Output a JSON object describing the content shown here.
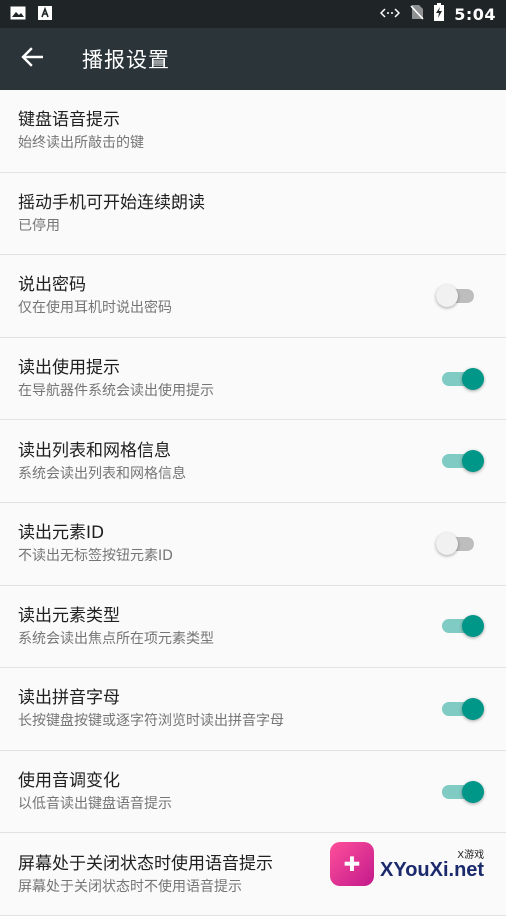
{
  "status_bar": {
    "time": "5:04",
    "icons": [
      "image-icon",
      "text-a-icon",
      "code-arrows-icon",
      "no-sim-icon",
      "battery-charging-icon"
    ]
  },
  "app_bar": {
    "title": "播报设置",
    "back_icon": "arrow-left-icon"
  },
  "settings": [
    {
      "title": "键盘语音提示",
      "subtitle": "始终读出所敲击的键",
      "toggle": null
    },
    {
      "title": "摇动手机可开始连续朗读",
      "subtitle": "已停用",
      "toggle": null
    },
    {
      "title": "说出密码",
      "subtitle": "仅在使用耳机时说出密码",
      "toggle": "off"
    },
    {
      "title": "读出使用提示",
      "subtitle": "在导航器件系统会读出使用提示",
      "toggle": "on"
    },
    {
      "title": "读出列表和网格信息",
      "subtitle": "系统会读出列表和网格信息",
      "toggle": "on"
    },
    {
      "title": "读出元素ID",
      "subtitle": "不读出无标签按钮元素ID",
      "toggle": "off"
    },
    {
      "title": "读出元素类型",
      "subtitle": "系统会读出焦点所在项元素类型",
      "toggle": "on"
    },
    {
      "title": "读出拼音字母",
      "subtitle": "长按键盘按键或逐字符浏览时读出拼音字母",
      "toggle": "on"
    },
    {
      "title": "使用音调变化",
      "subtitle": "以低音读出键盘语音提示",
      "toggle": "on"
    },
    {
      "title": "屏幕处于关闭状态时使用语音提示",
      "subtitle": "屏幕处于关闭状态时不使用语音提示",
      "toggle": null
    }
  ],
  "watermark": {
    "small": "X游戏",
    "main": "XYouXi.net"
  },
  "colors": {
    "accent": "#009688",
    "accent_track": "#80cbc4",
    "app_bar": "#2b3438",
    "status_bar": "#1f2427"
  }
}
